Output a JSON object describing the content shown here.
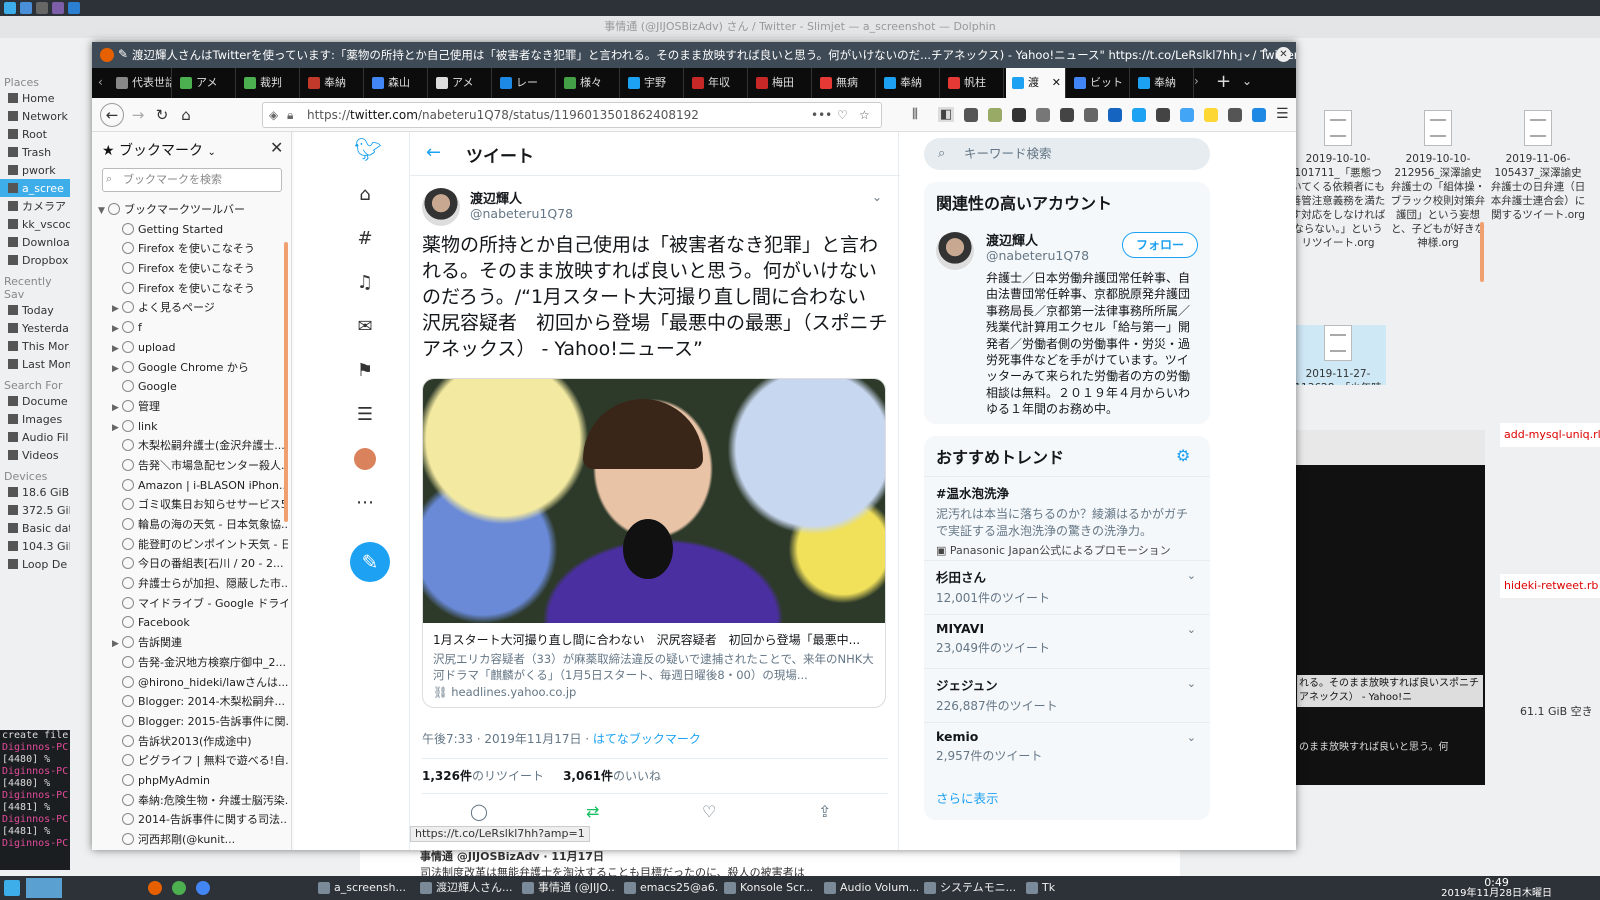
{
  "system": {
    "dolphin_title": "事情通 (@JIJOSBizAdv) さん / Twitter - Slimjet — a_screenshot — Dolphin"
  },
  "places": {
    "header_places": "Places",
    "items": [
      "Home",
      "Network",
      "Root",
      "Trash",
      "pwork",
      "a_scree",
      "カメラア",
      "kk_vscod",
      "Downloa",
      "Dropbox"
    ],
    "header_recent": "Recently Sav",
    "recent": [
      "Today",
      "Yesterda",
      "This Mor",
      "Last Mon"
    ],
    "header_search": "Search For",
    "search": [
      "Docume",
      "Images",
      "Audio Fil",
      "Videos"
    ],
    "header_devices": "Devices",
    "devices": [
      "18.6 GiB",
      "372.5 Gil",
      "Basic dat",
      "104.3 Gil",
      "Loop De"
    ]
  },
  "files": [
    {
      "name": "2019-10-10-101711_「悪態ついてくる依頼者にも善管注意義務を満たす対応をしなければならない。」というリツイート.org"
    },
    {
      "name": "2019-10-10-212956_深澤諭史弁護士の「組体操・ブラック校則対策弁護団」という妄想と、子どもが好きな神様.org"
    },
    {
      "name": "2019-11-06-105437_深澤諭史弁護士の日弁連（日本弁護士連合会）に関するツイート.org"
    },
    {
      "name": "2019-11-27-113628_「少年時代」と「弁護士に向"
    }
  ],
  "side": {
    "red1": "add-mysql-uniq.rl",
    "red2": "hideki-retweet.rb",
    "gib": "61.1 GiB 空き",
    "term_text": "れる。そのまま放映すれば良いスポニチアネックス） - Yahoo!ニ",
    "term_text2": "のまま放映すれば良いと思う。何"
  },
  "konsole": {
    "lines": [
      "create file",
      "Diginnos-PC",
      "[4480] % ",
      "Diginnos-PC",
      "[4480] % ",
      "Diginnos-PC",
      "[4481] % ",
      "Diginnos-PC",
      "[4481] % ",
      "Diginnos-PC"
    ]
  },
  "bottom_tweet": {
    "user": "事情通 @JIJOSBizAdv · 11月17日",
    "text": "司法制度改革は無能弁護士を淘汰することも目標だったのに、殺人の被害者は"
  },
  "firefox": {
    "window_title": "渡辺輝人さんはTwitterを使っています:「薬物の所持とか自己使用は「被害者なき犯罪」と言われる。そのまま放映すれば良いと思う。何がいけないのだ...チアネックス) - Yahoo!ニュース\" https://t.co/LeRslkl7hh」 / Twitter - Mozilla Firefox",
    "tabs": [
      {
        "label": "代表世話",
        "color": "#888"
      },
      {
        "label": "アメ",
        "color": "#4caf50"
      },
      {
        "label": "裁判",
        "color": "#4caf50"
      },
      {
        "label": "奉納",
        "color": "#c0392b"
      },
      {
        "label": "森山",
        "color": "#4285f4"
      },
      {
        "label": "アメ",
        "color": "#ddd"
      },
      {
        "label": "レー",
        "color": "#1e88e5"
      },
      {
        "label": "様々",
        "color": "#43a047"
      },
      {
        "label": "宇野",
        "color": "#1da1f2"
      },
      {
        "label": "年収",
        "color": "#c62828"
      },
      {
        "label": "梅田",
        "color": "#c62828"
      },
      {
        "label": "無病",
        "color": "#e53935"
      },
      {
        "label": "奉納",
        "color": "#1da1f2"
      },
      {
        "label": "帆柱",
        "color": "#e53935"
      },
      {
        "label": "渡",
        "color": "#1da1f2"
      },
      {
        "label": "ビット",
        "color": "#4285f4"
      },
      {
        "label": "奉納",
        "color": "#1da1f2"
      }
    ],
    "url_host": "twitter.com",
    "url_prefix": "https://",
    "url_path": "/nabeteru1Q78/status/1196013501862408192",
    "status_url": "https://t.co/LeRslkl7hh?amp=1"
  },
  "bookmarks": {
    "header": "ブックマーク",
    "search_placeholder": "ブックマークを検索",
    "items": [
      {
        "label": "ブックマークツールバー",
        "level": 0,
        "arrow": "▼"
      },
      {
        "label": "Getting Started",
        "level": 1,
        "arrow": ""
      },
      {
        "label": "Firefox を使いこなそう",
        "level": 1,
        "arrow": ""
      },
      {
        "label": "Firefox を使いこなそう",
        "level": 1,
        "arrow": ""
      },
      {
        "label": "Firefox を使いこなそう",
        "level": 1,
        "arrow": ""
      },
      {
        "label": "よく見るページ",
        "level": 1,
        "arrow": "▶"
      },
      {
        "label": "f",
        "level": 1,
        "arrow": "▶"
      },
      {
        "label": "upload",
        "level": 1,
        "arrow": "▶"
      },
      {
        "label": "Google Chrome から",
        "level": 1,
        "arrow": "▶"
      },
      {
        "label": "Google",
        "level": 1,
        "arrow": ""
      },
      {
        "label": "管理",
        "level": 1,
        "arrow": "▶"
      },
      {
        "label": "link",
        "level": 1,
        "arrow": "▶"
      },
      {
        "label": "木梨松嗣弁護士(金沢弁護士...",
        "level": 1,
        "arrow": ""
      },
      {
        "label": "告発＼市場急配センター殺人...",
        "level": 1,
        "arrow": ""
      },
      {
        "label": "Amazon | i-BLASON iPhon...",
        "level": 1,
        "arrow": ""
      },
      {
        "label": "ゴミ収集日お知らせサービス5...",
        "level": 1,
        "arrow": ""
      },
      {
        "label": "輪島の海の天気 - 日本気象協...",
        "level": 1,
        "arrow": ""
      },
      {
        "label": "能登町のピンポイント天気 - 日...",
        "level": 1,
        "arrow": ""
      },
      {
        "label": "今日の番組表[石川 / 20 - 2...",
        "level": 1,
        "arrow": ""
      },
      {
        "label": "弁護士らが加担、隠蔽した市...",
        "level": 1,
        "arrow": ""
      },
      {
        "label": "マイドライブ - Google ドライブ",
        "level": 1,
        "arrow": ""
      },
      {
        "label": "Facebook",
        "level": 1,
        "arrow": ""
      },
      {
        "label": "告訴関連",
        "level": 1,
        "arrow": "▶"
      },
      {
        "label": "告発-金沢地方検察庁御中_2...",
        "level": 1,
        "arrow": ""
      },
      {
        "label": "@hirono_hideki/lawさんは...",
        "level": 1,
        "arrow": ""
      },
      {
        "label": "Blogger: 2014-木梨松嗣弁...",
        "level": 1,
        "arrow": ""
      },
      {
        "label": "Blogger: 2015-告訴事件に関...",
        "level": 1,
        "arrow": ""
      },
      {
        "label": "告訴状2013(作成途中)",
        "level": 1,
        "arrow": ""
      },
      {
        "label": "ピグライフ | 無料で遊べる!自...",
        "level": 1,
        "arrow": ""
      },
      {
        "label": "phpMyAdmin",
        "level": 1,
        "arrow": ""
      },
      {
        "label": "奉納:危険生物・弁護士脳汚染...",
        "level": 1,
        "arrow": ""
      },
      {
        "label": "2014-告訴事件に関する司法...",
        "level": 1,
        "arrow": ""
      },
      {
        "label": "河西邦剛(@kunit...",
        "level": 1,
        "arrow": ""
      }
    ]
  },
  "tweet": {
    "page_title": "ツイート",
    "author": "渡辺輝人",
    "handle": "@nabeteru1Q78",
    "text": "薬物の所持とか自己使用は「被害者なき犯罪」と言われる。そのまま放映すれば良いと思う。何がいけないのだろう。/“1月スタート大河撮り直し間に合わない　沢尻容疑者　初回から登場「最悪中の最悪」（スポニチアネックス） - Yahoo!ニュース”",
    "card_title": "1月スタート大河撮り直し間に合わない　沢尻容疑者　初回から登場「最悪中...",
    "card_desc": "沢尻エリカ容疑者（33）が麻薬取締法違反の疑いで逮捕されたことで、来年のNHK大河ドラマ「麒麟がくる」（1月5日スタート、毎週日曜後8・00）の現場...",
    "card_url": "headlines.yahoo.co.jp",
    "time": "午後7:33 · 2019年11月17日 · ",
    "via": "はてなブックマーク",
    "retweets": "1,326件",
    "retweets_label": "のリツイート",
    "likes": "3,061件",
    "likes_label": "のいいね"
  },
  "right": {
    "search_placeholder": "キーワード検索",
    "rel_title": "関連性の高いアカウント",
    "rel_name": "渡辺輝人",
    "rel_handle": "@nabeteru1Q78",
    "follow": "フォロー",
    "rel_bio": "弁護士／日本労働弁護団常任幹事、自由法曹団常任幹事、京都脱原発弁護団事務局長／京都第一法律事務所所属／残業代計算用エクセル「給与第一」開発者／労働者側の労働事件・労災・過労死事件などを手がけています。ツイッターみて来られた労働者の方の労働相談は無料。２０１９年４月からいわゆる１年間のお務め中。",
    "trends_title": "おすすめトレンド",
    "trends": [
      {
        "name": "#温水泡洗浄",
        "count": "泥汚れは本当に落ちるのか？綾瀬はるかがガチで実証する温水泡洗浄の驚きの洗浄力。",
        "promo": "Panasonic Japan公式によるプロモーション"
      },
      {
        "name": "杉田さん",
        "count": "12,001件のツイート"
      },
      {
        "name": "MIYAVI",
        "count": "23,049件のツイート"
      },
      {
        "name": "ジェジュン",
        "count": "226,887件のツイート"
      },
      {
        "name": "kemio",
        "count": "2,957件のツイート"
      }
    ],
    "more": "さらに表示"
  },
  "taskbar": {
    "tasks": [
      "a_screensh...",
      "渡辺輝人さん...",
      "事情通 (@JIJO...",
      "emacs25@a6...",
      "Konsole Scr...",
      "Audio Volum...",
      "システムモニ...",
      "Tk"
    ],
    "clock_time": "0:49",
    "clock_date": "2019年11月28日木曜日"
  }
}
